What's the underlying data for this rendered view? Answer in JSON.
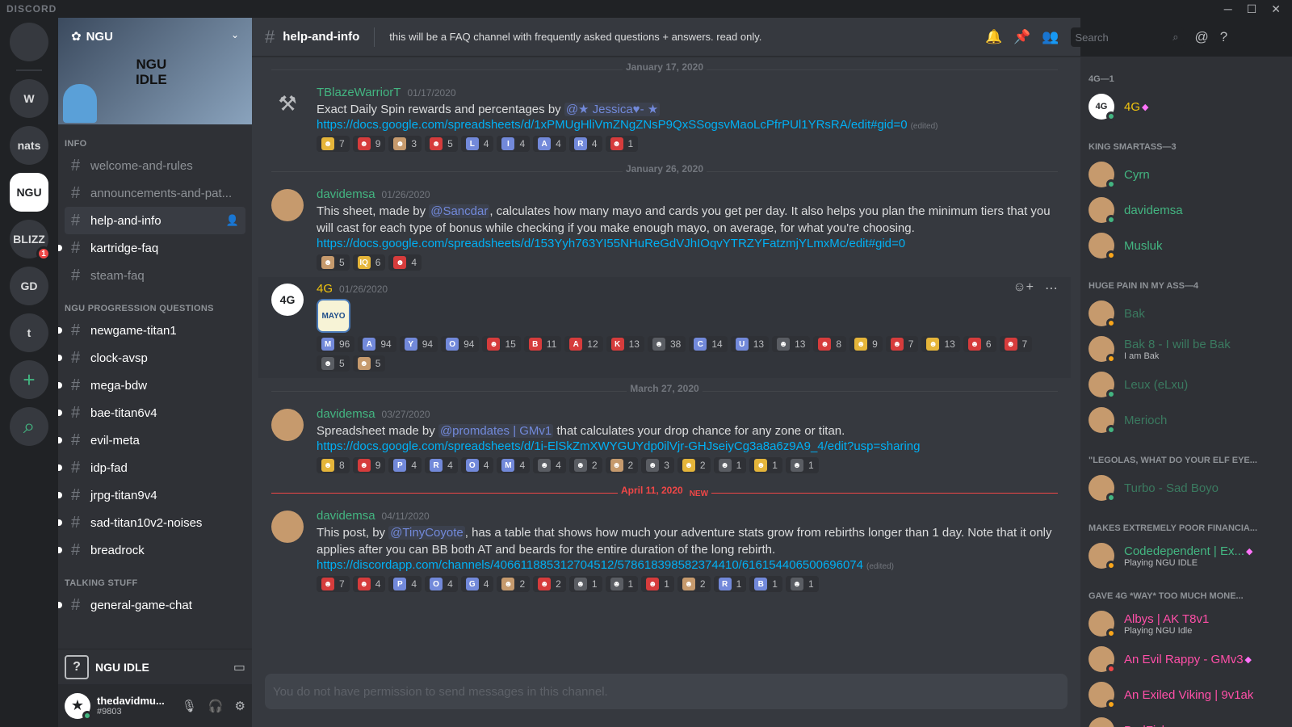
{
  "app": {
    "brand": "DISCORD",
    "window_controls": [
      "─",
      "☐",
      "✕"
    ]
  },
  "guilds": [
    {
      "label": "",
      "icon": "discord-home-icon"
    },
    {
      "label": "W",
      "icon": "w-server-icon"
    },
    {
      "label": "nats",
      "icon": "nats-server-icon"
    },
    {
      "label": "NGU",
      "icon": "ngu-server-icon",
      "selected": true
    },
    {
      "label": "BLIZZ",
      "icon": "blizz-server-icon",
      "badge": "1"
    },
    {
      "label": "GD",
      "icon": "gd-server-icon"
    },
    {
      "label": "t",
      "icon": "t-server-icon"
    },
    {
      "label": "+",
      "icon": "add-server-icon"
    },
    {
      "label": "⌕",
      "icon": "discover-icon"
    }
  ],
  "server": {
    "name": "NGU",
    "logo_line1": "NGU",
    "logo_line2": "IDLE"
  },
  "categories": [
    {
      "name": "INFO",
      "channels": [
        {
          "name": "welcome-and-rules"
        },
        {
          "name": "announcements-and-pat..."
        },
        {
          "name": "help-and-info",
          "selected": true
        },
        {
          "name": "kartridge-faq",
          "unread": true
        },
        {
          "name": "steam-faq"
        }
      ]
    },
    {
      "name": "NGU PROGRESSION QUESTIONS",
      "channels": [
        {
          "name": "newgame-titan1",
          "unread": true
        },
        {
          "name": "clock-avsp",
          "unread": true
        },
        {
          "name": "mega-bdw",
          "unread": true
        },
        {
          "name": "bae-titan6v4",
          "unread": true
        },
        {
          "name": "evil-meta",
          "unread": true
        },
        {
          "name": "idp-fad",
          "unread": true
        },
        {
          "name": "jrpg-titan9v4",
          "unread": true
        },
        {
          "name": "sad-titan10v2-noises",
          "unread": true
        },
        {
          "name": "breadrock",
          "unread": true
        }
      ]
    },
    {
      "name": "TALKING STUFF",
      "channels": [
        {
          "name": "general-game-chat",
          "unread": true
        }
      ]
    }
  ],
  "voice": {
    "label": "NGU IDLE"
  },
  "user": {
    "name": "thedavidmu...",
    "tag": "#9803"
  },
  "header": {
    "channel": "help-and-info",
    "topic": "this will be a FAQ channel with frequently asked questions + answers. read only.",
    "search_placeholder": "Search"
  },
  "messages": [
    {
      "type": "divider",
      "label": "January 17, 2020"
    },
    {
      "type": "msg",
      "author": "TBlazeWarriorT",
      "ts": "01/17/2020",
      "avatar": "hammer",
      "text_before": "Exact Daily Spin rewards and percentages by ",
      "mention": "@★ Jessica♥- ★",
      "text_after": "",
      "link": "https://docs.google.com/spreadsheets/d/1xPMUgHliVmZNgZNsP9QxSSogsvMaoLcPfrPUl1YRsRA/edit#gid=0",
      "edited": "(edited)",
      "reactions": [
        [
          "☻",
          "7",
          "gold"
        ],
        [
          "☻",
          "9",
          "red"
        ],
        [
          "☻",
          "3",
          "brown"
        ],
        [
          "☻",
          "5",
          "red"
        ],
        [
          "L",
          "4",
          ""
        ],
        [
          "I",
          "4",
          ""
        ],
        [
          "A",
          "4",
          ""
        ],
        [
          "R",
          "4",
          ""
        ],
        [
          "☻",
          "1",
          "red"
        ]
      ]
    },
    {
      "type": "divider",
      "label": "January 26, 2020"
    },
    {
      "type": "msg",
      "author": "davidemsa",
      "ts": "01/26/2020",
      "avatar": "brown",
      "text_before": "This sheet, made by ",
      "mention": "@Sancdar",
      "text_after": ", calculates how many mayo and cards you get per day. It also helps you plan the minimum tiers that you will cast for each type of bonus while checking if you make enough mayo, on average, for what you're choosing.",
      "link": "https://docs.google.com/spreadsheets/d/153Yyh763YI55NHuReGdVJhIOqvYTRZYFatzmjYLmxMc/edit#gid=0",
      "edited": "",
      "reactions": [
        [
          "☻",
          "5",
          "brown"
        ],
        [
          "IQ",
          "6",
          "gold"
        ],
        [
          "☻",
          "4",
          "red"
        ]
      ]
    },
    {
      "type": "msg",
      "author": "4G",
      "ts": "01/26/2020",
      "avatar": "white",
      "gold": true,
      "jar": "MAYO",
      "hover": true,
      "text_before": "",
      "mention": "",
      "text_after": "",
      "link": "",
      "edited": "",
      "reactions": [
        [
          "M",
          "96",
          ""
        ],
        [
          "A",
          "94",
          ""
        ],
        [
          "Y",
          "94",
          ""
        ],
        [
          "O",
          "94",
          ""
        ],
        [
          "☻",
          "15",
          "red"
        ],
        [
          "B",
          "11",
          "red"
        ],
        [
          "A",
          "12",
          "red"
        ],
        [
          "K",
          "13",
          "red"
        ],
        [
          "☻",
          "38",
          "gray"
        ],
        [
          "C",
          "14",
          ""
        ],
        [
          "U",
          "13",
          ""
        ],
        [
          "☻",
          "13",
          "gray"
        ],
        [
          "☻",
          "8",
          "red"
        ],
        [
          "☻",
          "9",
          "gold"
        ],
        [
          "☻",
          "7",
          "red"
        ],
        [
          "☻",
          "13",
          "gold"
        ],
        [
          "☻",
          "6",
          "red"
        ],
        [
          "☻",
          "7",
          "red"
        ],
        [
          "☻",
          "5",
          "gray"
        ],
        [
          "☻",
          "5",
          "brown"
        ]
      ]
    },
    {
      "type": "divider",
      "label": "March 27, 2020"
    },
    {
      "type": "msg",
      "author": "davidemsa",
      "ts": "03/27/2020",
      "avatar": "brown",
      "text_before": "Spreadsheet made by ",
      "mention": "@promdates | GMv1",
      "text_after": " that calculates your drop chance for any zone or titan.",
      "link": "https://docs.google.com/spreadsheets/d/1i-ElSkZmXWYGUYdp0ilVjr-GHJseiyCg3a8a6z9A9_4/edit?usp=sharing",
      "edited": "",
      "reactions": [
        [
          "☻",
          "8",
          "gold"
        ],
        [
          "☻",
          "9",
          "red"
        ],
        [
          "P",
          "4",
          ""
        ],
        [
          "R",
          "4",
          ""
        ],
        [
          "O",
          "4",
          ""
        ],
        [
          "M",
          "4",
          ""
        ],
        [
          "☻",
          "4",
          "gray"
        ],
        [
          "☻",
          "2",
          "gray"
        ],
        [
          "☻",
          "2",
          "brown"
        ],
        [
          "☻",
          "3",
          "gray"
        ],
        [
          "☻",
          "2",
          "gold"
        ],
        [
          "☻",
          "1",
          "gray"
        ],
        [
          "☻",
          "1",
          "gold"
        ],
        [
          "☻",
          "1",
          "gray"
        ]
      ]
    },
    {
      "type": "divider",
      "label": "April 11, 2020",
      "new": true,
      "new_label": "NEW"
    },
    {
      "type": "msg",
      "author": "davidemsa",
      "ts": "04/11/2020",
      "avatar": "brown",
      "text_before": "This post, by ",
      "mention": "@TinyCoyote",
      "text_after": ", has a table that shows how much your adventure stats grow from rebirths longer than 1 day. Note that it only applies after you can BB both AT and beards for the entire duration of the long rebirth.",
      "link": "https://discordapp.com/channels/406611885312704512/578618398582374410/616154406500696074",
      "edited": "(edited)",
      "reactions": [
        [
          "☻",
          "7",
          "red"
        ],
        [
          "☻",
          "4",
          "red"
        ],
        [
          "P",
          "4",
          ""
        ],
        [
          "O",
          "4",
          ""
        ],
        [
          "G",
          "4",
          ""
        ],
        [
          "☻",
          "2",
          "brown"
        ],
        [
          "☻",
          "2",
          "red"
        ],
        [
          "☻",
          "1",
          "gray"
        ],
        [
          "☻",
          "1",
          "gray"
        ],
        [
          "☻",
          "1",
          "red"
        ],
        [
          "☻",
          "2",
          "brown"
        ],
        [
          "R",
          "1",
          ""
        ],
        [
          "B",
          "1",
          ""
        ],
        [
          "☻",
          "1",
          "gray"
        ]
      ]
    }
  ],
  "input": {
    "placeholder": "You do not have permission to send messages in this channel."
  },
  "member_groups": [
    {
      "title": "4G—1",
      "members": [
        {
          "name": "4G",
          "color": "gold",
          "boost": true,
          "status": ""
        }
      ]
    },
    {
      "title": "KING SMARTASS—3",
      "members": [
        {
          "name": "Cyrn",
          "color": "",
          "status": ""
        },
        {
          "name": "davidemsa",
          "color": "",
          "status": ""
        },
        {
          "name": "Musluk",
          "color": "",
          "status": "idle"
        }
      ]
    },
    {
      "title": "HUGE PAIN IN MY ASS—4",
      "members": [
        {
          "name": "Bak",
          "color": "",
          "faded": true,
          "status": "idle"
        },
        {
          "name": "Bak 8 - I will be Bak",
          "color": "",
          "faded": true,
          "sub": "I am Bak",
          "status": "idle"
        },
        {
          "name": "Leux (eLxu)",
          "color": "",
          "faded": true,
          "status": ""
        },
        {
          "name": "Merioch",
          "color": "",
          "faded": true,
          "status": ""
        }
      ]
    },
    {
      "title": "\"LEGOLAS, WHAT DO YOUR ELF EYE...",
      "members": [
        {
          "name": "Turbo - Sad Boyo",
          "color": "",
          "faded": true,
          "status": ""
        }
      ]
    },
    {
      "title": "MAKES EXTREMELY POOR FINANCIA...",
      "members": [
        {
          "name": "Codedependent | Ex...",
          "color": "",
          "boost": true,
          "sub": "Playing NGU IDLE",
          "status": "idle"
        }
      ]
    },
    {
      "title": "GAVE 4G *WAY* TOO MUCH MONE...",
      "members": [
        {
          "name": "Albys | AK T8v1",
          "color": "pink",
          "sub": "Playing NGU Idle",
          "status": "idle"
        },
        {
          "name": "An Evil Rappy - GMv3",
          "color": "pink",
          "boost": true,
          "status": "dnd"
        },
        {
          "name": "An Exiled Viking | 9v1ak",
          "color": "pink",
          "status": "idle"
        },
        {
          "name": "BadFish",
          "color": "pink",
          "status": ""
        }
      ]
    }
  ]
}
